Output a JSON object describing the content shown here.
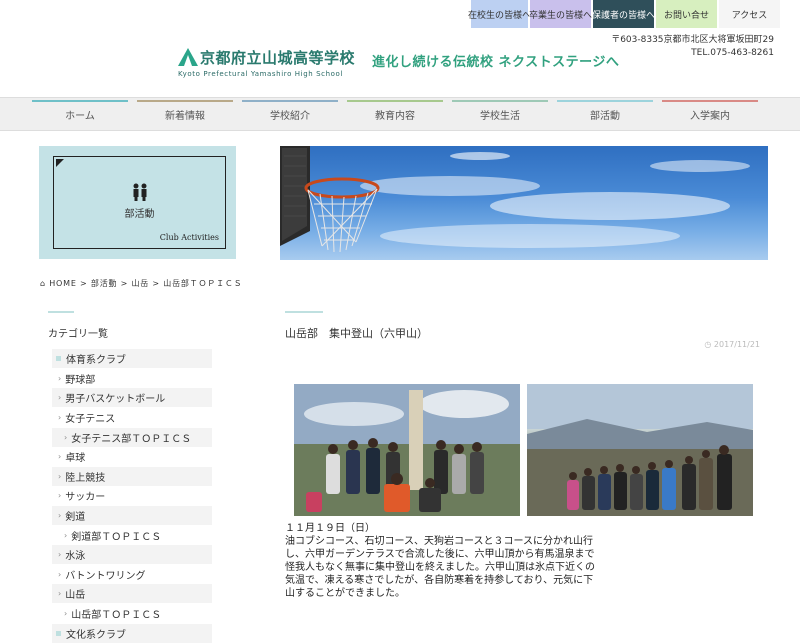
{
  "top_links": [
    {
      "label": "在校生の皆様へ",
      "color": "#bcd0f2"
    },
    {
      "label": "卒業生の皆様へ",
      "color": "#c9c0ec"
    },
    {
      "label": "保護者の皆様へ",
      "color": "#2f4f5a"
    },
    {
      "label": "お問い合せ",
      "color": "#d7efbf"
    },
    {
      "label": "アクセス",
      "color": "#f5f5f5"
    }
  ],
  "header": {
    "school_name": "京都府立山城高等学校",
    "school_name_en": "Kyoto Prefectural Yamashiro High School",
    "tagline": "進化し続ける伝統校 ネクストステージへ",
    "address": "〒603-8335京都市北区大将軍坂田町29",
    "tel": "TEL.075-463-8261"
  },
  "nav": [
    {
      "label": "ホーム",
      "color": "#6fc0c8"
    },
    {
      "label": "新着情報",
      "color": "#b9a989"
    },
    {
      "label": "学校紹介",
      "color": "#8fb0c8"
    },
    {
      "label": "教育内容",
      "color": "#a7c98e"
    },
    {
      "label": "学校生活",
      "color": "#9ec9b6"
    },
    {
      "label": "部活動",
      "color": "#9cd3dc"
    },
    {
      "label": "入学案内",
      "color": "#d98a86"
    }
  ],
  "side_banner": {
    "label": "部活動",
    "label_en": "Club Activities",
    "icon": "people-icon"
  },
  "breadcrumb": "HOME > 部活動 > 山岳 > 山岳部ＴＯＰＩＣＳ",
  "category": {
    "title": "カテゴリ一覧",
    "items": [
      {
        "label": "体育系クラブ",
        "level": 0
      },
      {
        "label": "野球部",
        "level": 1
      },
      {
        "label": "男子バスケットボール",
        "level": 1
      },
      {
        "label": "女子テニス",
        "level": 1
      },
      {
        "label": "女子テニス部ＴＯＰＩＣＳ",
        "level": 2
      },
      {
        "label": "卓球",
        "level": 1
      },
      {
        "label": "陸上競技",
        "level": 1
      },
      {
        "label": "サッカー",
        "level": 1
      },
      {
        "label": "剣道",
        "level": 1
      },
      {
        "label": "剣道部ＴＯＰＩＣＳ",
        "level": 2
      },
      {
        "label": "水泳",
        "level": 1
      },
      {
        "label": "バトントワリング",
        "level": 1
      },
      {
        "label": "山岳",
        "level": 1
      },
      {
        "label": "山岳部ＴＯＰＩＣＳ",
        "level": 2
      },
      {
        "label": "文化系クラブ",
        "level": 0
      }
    ]
  },
  "article": {
    "title": "山岳部　集中登山（六甲山）",
    "date": "2017/11/21",
    "date_line": "１１月１９日（日）",
    "body": "油コブシコース、石切コース、天狗岩コースと３コースに分かれ山行し、六甲ガーデンテラスで合流した後に、六甲山頂から有馬温泉まで怪我人もなく無事に集中登山を終えました。六甲山頂は氷点下近くの気温で、凍える寒さでしたが、各自防寒着を持参しており、元気に下山することができました。"
  }
}
